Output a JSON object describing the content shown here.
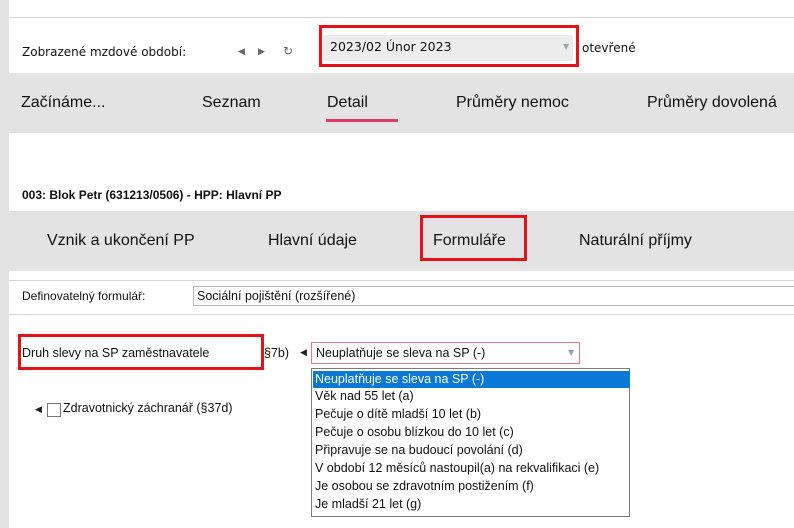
{
  "period": {
    "label": "Zobrazené mzdové období:",
    "value": "2023/02 Únor 2023",
    "status": "otevřené"
  },
  "nav_main": {
    "items": [
      "Začínáme...",
      "Seznam",
      "Detail",
      "Průměry nemoc",
      "Průměry dovolená"
    ],
    "active": "Detail"
  },
  "employee": {
    "title": "003: Blok Petr (631213/0506) - HPP: Hlavní PP"
  },
  "nav_detail": {
    "items": [
      "Vznik a ukončení PP",
      "Hlavní údaje",
      "Formuláře",
      "Naturální příjmy"
    ],
    "active": "Formuláře"
  },
  "form": {
    "label": "Definovatelný formulář:",
    "value": "Sociální pojištění (rozšířené)"
  },
  "druh_slevy": {
    "label": "Druh slevy na SP zaměstnavatele",
    "paragraph": "§7b)",
    "selected": "Neuplatňuje se sleva na SP (-)",
    "options": [
      "Neuplatňuje se sleva na SP (-)",
      "Věk nad 55 let (a)",
      "Pečuje o dítě mladší 10 let (b)",
      "Pečuje o osobu blízkou do 10 let (c)",
      "Připravuje se na budoucí povolání (d)",
      "V období 12 měsíců nastoupil(a) na rekvalifikaci (e)",
      "Je osobou se zdravotním postižením (f)",
      "Je mladší 21 let (g)"
    ]
  },
  "zachranar": {
    "label": "Zdravotnický záchranář (§37d)",
    "checked": false
  },
  "icons": {
    "prev": "triangle-left-icon",
    "next": "triangle-right-icon",
    "refresh": "refresh-icon",
    "dropdown": "chevron-down-icon"
  },
  "colors": {
    "highlight_box": "#e3121b",
    "active_underline": "#e03a6a",
    "selected_option": "#0a78d7",
    "nav_background": "#e3e3e3"
  }
}
